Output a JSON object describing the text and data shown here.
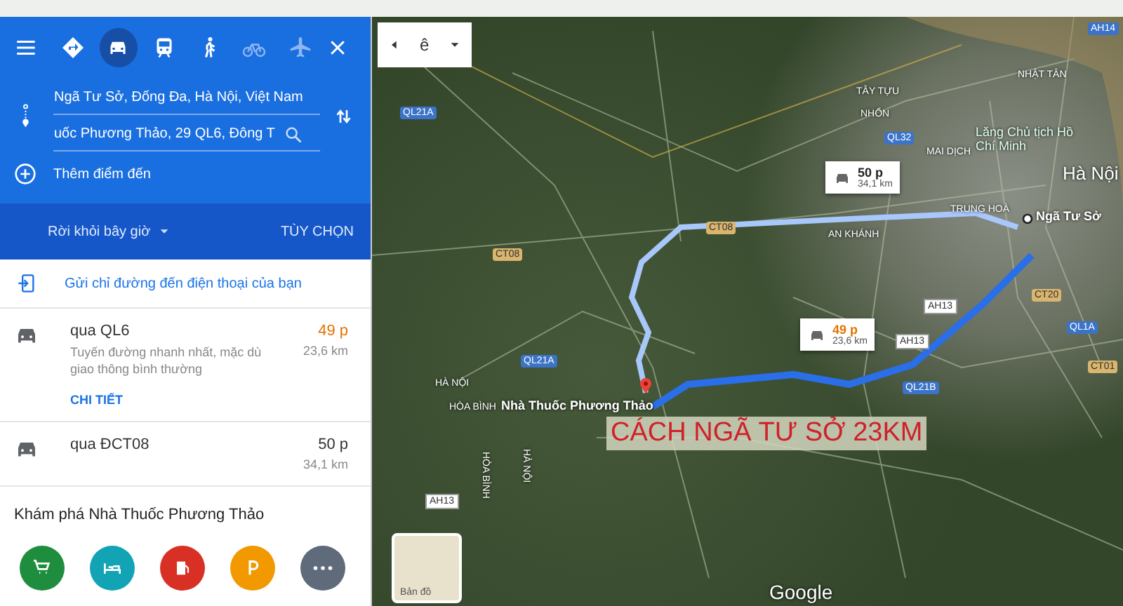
{
  "sidebar": {
    "travel_modes": [
      {
        "kind": "best",
        "selected": false
      },
      {
        "kind": "car",
        "selected": true
      },
      {
        "kind": "transit",
        "selected": false
      },
      {
        "kind": "walk",
        "selected": false
      },
      {
        "kind": "bike",
        "selected": false
      },
      {
        "kind": "plane",
        "selected": false
      }
    ],
    "origin": {
      "value": "Ngã Tư Sở, Đống Đa, Hà Nội, Việt Nam"
    },
    "destination": {
      "value": "uốc Phương Thảo, 29 QL6, Đông T"
    },
    "add_stop": "Thêm điểm đến",
    "depart": "Rời khỏi bây giờ",
    "options": "TÙY CHỌN",
    "send_link": "Gửi chỉ đường đến điện thoại của bạn",
    "routes": [
      {
        "name": "qua QL6",
        "time": "49 p",
        "distance": "23,6 km",
        "description": "Tuyến đường nhanh nhất, mặc dù giao thông bình thường",
        "details": "CHI TIẾT",
        "fastest": true
      },
      {
        "name": "qua ĐCT08",
        "time": "50 p",
        "distance": "34,1 km",
        "fastest": false
      }
    ],
    "explore": {
      "title": "Khám phá Nhà Thuốc Phương Thảo",
      "categories": [
        {
          "kind": "cart",
          "color": "#1e8e3e"
        },
        {
          "kind": "hotel",
          "color": "#12a4b5"
        },
        {
          "kind": "fuel",
          "color": "#d93025"
        },
        {
          "kind": "parking",
          "color": "#f29900"
        },
        {
          "kind": "more",
          "color": "#5f6b7a"
        }
      ]
    }
  },
  "map": {
    "layer_menu": "ê",
    "labels": [
      {
        "text": "AH14",
        "kind": "road"
      },
      {
        "text": "NHẬT TÂN",
        "kind": "place"
      },
      {
        "text": "TÂY TỰU",
        "kind": "place"
      },
      {
        "text": "NHỔN",
        "kind": "place"
      },
      {
        "text": "QL21A",
        "kind": "road"
      },
      {
        "text": "QL32",
        "kind": "road"
      },
      {
        "text": "MAI DỊCH",
        "kind": "place"
      },
      {
        "text": "Lăng Chủ tịch Hồ Chí Minh",
        "kind": "poi"
      },
      {
        "text": "Hà Nội",
        "kind": "city"
      },
      {
        "text": "TRUNG HOÀ",
        "kind": "place"
      },
      {
        "text": "AN KHÁNH",
        "kind": "place"
      },
      {
        "text": "CT08",
        "kind": "highway"
      },
      {
        "text": "CT08",
        "kind": "highway"
      },
      {
        "text": "QL21A",
        "kind": "road"
      },
      {
        "text": "HÀ NỘI",
        "kind": "place"
      },
      {
        "text": "HÒA BÌNH",
        "kind": "place"
      },
      {
        "text": "AH13",
        "kind": "shield"
      },
      {
        "text": "AH13",
        "kind": "shield"
      },
      {
        "text": "AH13",
        "kind": "shield"
      },
      {
        "text": "CT20",
        "kind": "highway"
      },
      {
        "text": "QL1A",
        "kind": "road"
      },
      {
        "text": "CT01",
        "kind": "highway"
      },
      {
        "text": "QL21B",
        "kind": "road"
      },
      {
        "text": "HÒA BÌNH",
        "kind": "vertical"
      },
      {
        "text": "HÀ NỘI",
        "kind": "vertical"
      }
    ],
    "route_callouts": [
      {
        "time": "50 p",
        "distance": "34,1 km",
        "selected": false
      },
      {
        "time": "49 p",
        "distance": "23,6 km",
        "selected": true
      }
    ],
    "origin_label": "Ngã Tư Sở",
    "destination_label": "Nhà Thuốc Phương Thảo",
    "annotation": "CÁCH NGÃ TƯ SỞ 23KM",
    "layer_thumb": "Bản đồ",
    "logo": "Google"
  }
}
